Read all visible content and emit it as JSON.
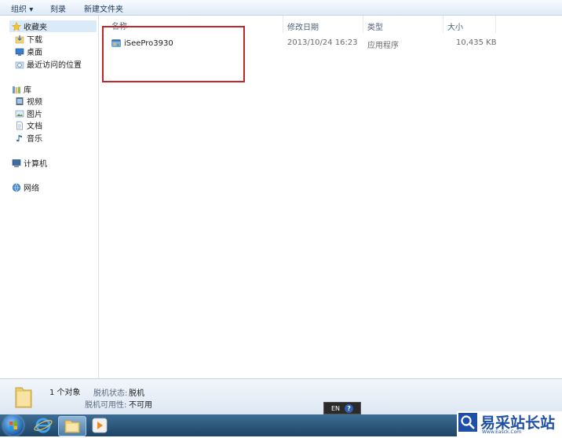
{
  "toolbar": {
    "organize": "组织",
    "organize_arrow": "▾",
    "burn": "刻录",
    "new_folder": "新建文件夹"
  },
  "sidebar": {
    "favorites": "收藏夹",
    "downloads": "下载",
    "desktop": "桌面",
    "recent": "最近访问的位置",
    "libraries": "库",
    "videos": "视频",
    "pictures": "图片",
    "documents": "文档",
    "music": "音乐",
    "computer": "计算机",
    "network": "网络"
  },
  "columns": {
    "name": "名称",
    "modified": "修改日期",
    "type": "类型",
    "size": "大小"
  },
  "files": [
    {
      "name": "iSeePro3930",
      "modified": "2013/10/24 16:23",
      "type": "应用程序",
      "size": "10,435 KB"
    }
  ],
  "status": {
    "count": "1 个对象",
    "offline_status_label": "脱机状态:",
    "offline_status_value": "脱机",
    "offline_avail_label": "脱机可用性:",
    "offline_avail_value": "不可用"
  },
  "language_bar": {
    "lang": "EN",
    "help": "?"
  },
  "watermark": {
    "text": "易采站长站",
    "url": "Www.Easck.Com"
  },
  "colors": {
    "accent": "#1e395b",
    "highlight_border": "#c0262c",
    "taskbar": "#2b5478"
  }
}
